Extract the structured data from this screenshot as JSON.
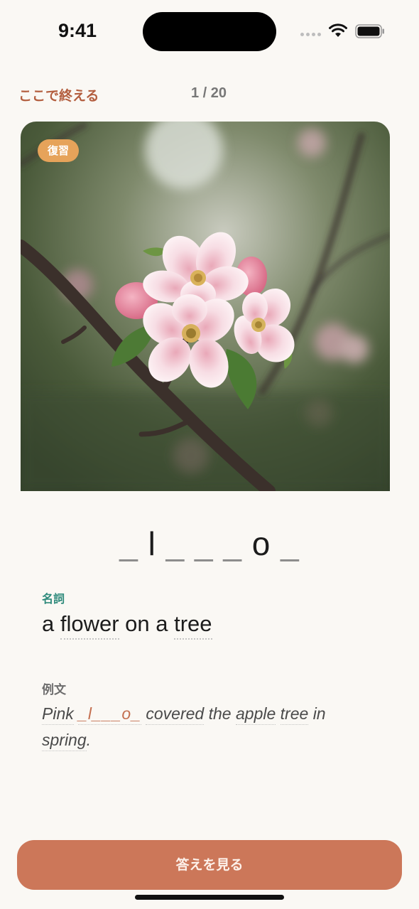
{
  "status_bar": {
    "time": "9:41"
  },
  "header": {
    "end_label": "ここで終える",
    "progress": "1 / 20",
    "progress_current": 1,
    "progress_total": 20
  },
  "card": {
    "badge": "復習",
    "image_icon": "apple-blossom-photo"
  },
  "word_hint": {
    "pattern": [
      "_",
      "l",
      "_",
      "_",
      "_",
      "o",
      "_"
    ]
  },
  "definition": {
    "part_of_speech": "名詞",
    "text_part1": "a ",
    "text_word1": "flower",
    "text_part2": " on a ",
    "text_word2": "tree"
  },
  "example": {
    "label": "例文",
    "w1": "Pink",
    "target": "_l___o_",
    "w2": "covered",
    "w3": "the",
    "w4": "apple",
    "w5": "tree",
    "w6": "in",
    "w7": "spring",
    "end": "."
  },
  "actions": {
    "reveal_label": "答えを見る"
  },
  "colors": {
    "accent": "#cc7759",
    "end_link": "#b35e3f",
    "badge": "#e6a35a",
    "pos": "#2e8a7b",
    "background": "#faf8f4"
  }
}
